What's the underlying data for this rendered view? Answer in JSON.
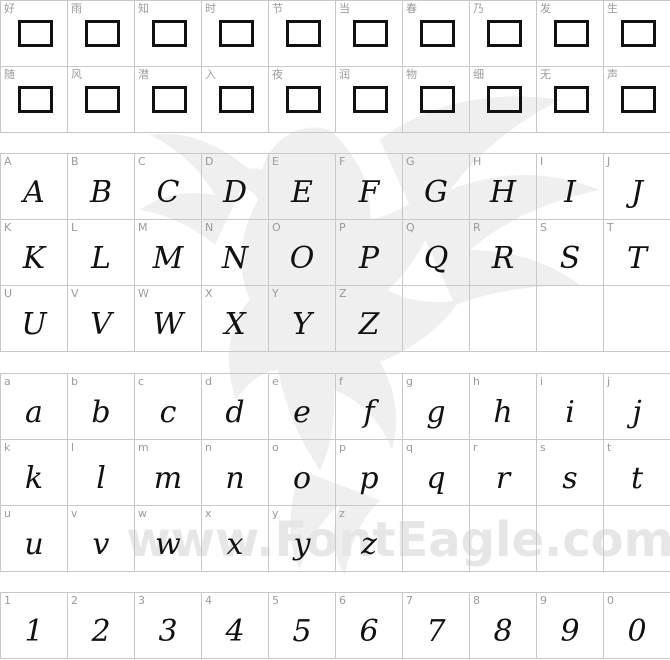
{
  "watermark": {
    "text": "www.FontEagle.com",
    "color": "#e6e6e6"
  },
  "sections": [
    {
      "id": "g-cjk",
      "name": "cjk-glyph-grid",
      "kind": "notdef",
      "cells": [
        "好",
        "雨",
        "知",
        "时",
        "节",
        "当",
        "春",
        "乃",
        "发",
        "生",
        "随",
        "风",
        "潜",
        "入",
        "夜",
        "润",
        "物",
        "细",
        "无",
        "声"
      ]
    },
    {
      "id": "g-upper",
      "name": "uppercase-glyph-grid",
      "kind": "glyph",
      "cells": [
        "A",
        "B",
        "C",
        "D",
        "E",
        "F",
        "G",
        "H",
        "I",
        "J",
        "K",
        "L",
        "M",
        "N",
        "O",
        "P",
        "Q",
        "R",
        "S",
        "T",
        "U",
        "V",
        "W",
        "X",
        "Y",
        "Z",
        "",
        "",
        " ",
        ""
      ]
    },
    {
      "id": "g-lower",
      "name": "lowercase-glyph-grid",
      "kind": "glyph",
      "cells": [
        "a",
        "b",
        "c",
        "d",
        "e",
        "f",
        "g",
        "h",
        "i",
        "j",
        "k",
        "l",
        "m",
        "n",
        "o",
        "p",
        "q",
        "r",
        "s",
        "t",
        "u",
        "v",
        "w",
        "x",
        "y",
        "z"
      ]
    },
    {
      "id": "g-digits",
      "name": "digit-glyph-grid",
      "kind": "glyph",
      "cells": [
        "1",
        "2",
        "3",
        "4",
        "5",
        "6",
        "7",
        "8",
        "9",
        "0"
      ]
    }
  ]
}
